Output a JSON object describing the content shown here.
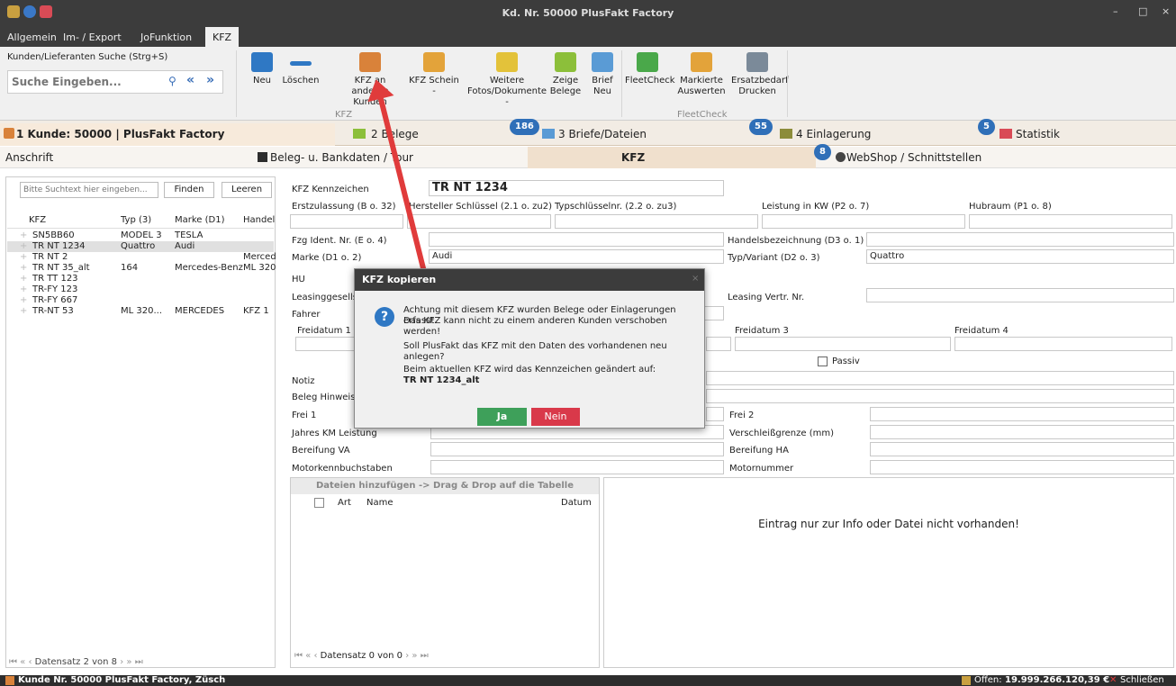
{
  "window": {
    "title": "Kd. Nr. 50000 PlusFakt Factory",
    "min": "–",
    "max": "□",
    "close": "×"
  },
  "menu": [
    "Allgemein",
    "Im- / Export",
    "JoFunktion",
    "KFZ"
  ],
  "search": {
    "label": "Kunden/Lieferanten Suche (Strg+S)",
    "placeholder": "Suche Eingeben..."
  },
  "ribbon": {
    "buttons": [
      {
        "label": "Neu"
      },
      {
        "label": "Löschen"
      },
      {
        "label": "KFZ an anderen Kunden"
      },
      {
        "label": "KFZ Schein -"
      },
      {
        "label": "Weitere Fotos/Dokumente -"
      },
      {
        "label": "Zeige Belege"
      },
      {
        "label": "Brief Neu"
      },
      {
        "label": "FleetCheck"
      },
      {
        "label": "Markierte Auswerten"
      },
      {
        "label": "Ersatzbedarf Drucken"
      }
    ],
    "groups": [
      "KFZ",
      "FleetCheck"
    ]
  },
  "tabs_main": [
    {
      "label": "1 Kunde: 50000 | PlusFakt Factory"
    },
    {
      "label": "2 Belege",
      "badge": "186"
    },
    {
      "label": "3 Briefe/Dateien",
      "badge": "55"
    },
    {
      "label": "4 Einlagerung",
      "badge": "5"
    },
    {
      "label": "Statistik"
    }
  ],
  "tabs_sub": [
    {
      "label": "Anschrift"
    },
    {
      "label": "Beleg- u. Bankdaten / Tour"
    },
    {
      "label": "KFZ"
    },
    {
      "label": "WebShop / Schnittstellen",
      "badge": "8"
    }
  ],
  "left": {
    "search_placeholder": "Bitte Suchtext hier eingeben...",
    "find": "Finden",
    "clear": "Leeren",
    "columns": [
      "KFZ",
      "Typ (3)",
      "Marke (D1)",
      "Handel"
    ],
    "rows": [
      [
        "SN5BB60",
        "MODEL 3",
        "TESLA",
        ""
      ],
      [
        "TR NT 1234",
        "Quattro",
        "Audi",
        ""
      ],
      [
        "TR NT 2",
        "",
        "",
        "Merced"
      ],
      [
        "TR NT 35_alt",
        "164",
        "Mercedes-Benz",
        "ML 320"
      ],
      [
        "TR TT 123",
        "",
        "",
        ""
      ],
      [
        "TR-FY 123",
        "",
        "",
        ""
      ],
      [
        "TR-FY 667",
        "",
        "",
        ""
      ],
      [
        "TR-NT 53",
        "ML 320...",
        "MERCEDES",
        "KFZ 1"
      ]
    ],
    "record": "Datensatz 2 von 8"
  },
  "form": {
    "kennzeichen_label": "KFZ Kennzeichen",
    "kennzeichen": "TR NT 1234",
    "erstzulassung": "Erstzulassung (B o. 32)",
    "hersteller": "Hersteller Schlüssel (2.1 o. zu2)",
    "typschluessel": "Typschlüsselnr. (2.2 o. zu3)",
    "leistung": "Leistung in KW (P2 o. 7)",
    "hubraum": "Hubraum (P1 o. 8)",
    "fzg_ident": "Fzg Ident. Nr. (E o. 4)",
    "handelsbez": "Handelsbezeichnung (D3 o. 1)",
    "marke_label": "Marke (D1 o. 2)",
    "marke": "Audi",
    "typ_label": "Typ/Variant (D2 o. 3)",
    "typ": "Quattro",
    "hu": "HU",
    "leasing_ges": "Leasinggesellsch",
    "leasing_vertr": "Leasing Vertr. Nr.",
    "fahrer": "Fahrer",
    "freidatum1": "Freidatum 1",
    "freidatum3": "Freidatum 3",
    "freidatum4": "Freidatum 4",
    "passiv": "Passiv",
    "notiz": "Notiz",
    "beleg_hinweis": "Beleg Hinweis",
    "frei1": "Frei 1",
    "frei2": "Frei 2",
    "jahres_km": "Jahres KM Leistung",
    "verschleiss": "Verschleißgrenze (mm)",
    "bereifung_va": "Bereifung VA",
    "bereifung_ha": "Bereifung HA",
    "motorkenn": "Motorkennbuchstaben",
    "motornummer": "Motornummer"
  },
  "files": {
    "header": "Dateien hinzufügen -> Drag & Drop auf die Tabelle",
    "col_art": "Art",
    "col_name": "Name",
    "col_datum": "Datum",
    "record": "Datensatz 0 von 0",
    "preview": "Eintrag nur zur Info oder Datei nicht vorhanden!"
  },
  "dialog": {
    "title": "KFZ kopieren",
    "line1": "Achtung mit diesem KFZ wurden Belege oder Einlagerungen erfasst.",
    "line2": "Das KFZ kann nicht zu einem anderen Kunden verschoben werden!",
    "line3": "Soll PlusFakt das KFZ mit den Daten des vorhandenen neu anlegen?",
    "line4": "Beim aktuellen KFZ wird das Kennzeichen geändert auf:",
    "line5": "TR NT 1234_alt",
    "yes": "Ja",
    "no": "Nein"
  },
  "status": {
    "left": "Kunde Nr. 50000 PlusFakt Factory, Züsch",
    "offen_label": "Offen:",
    "offen_value": "19.999.266.120,39 €",
    "close": "Schließen"
  }
}
